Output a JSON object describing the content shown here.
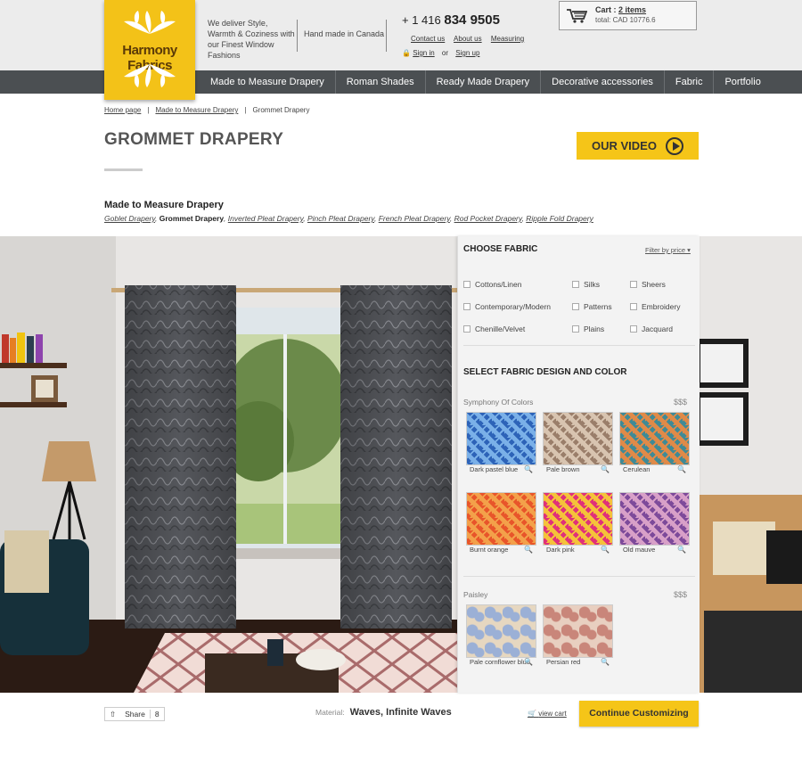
{
  "brand": {
    "name": "Harmony Fabrics"
  },
  "header": {
    "tagline": "We deliver Style, Warmth & Coziness with our Finest Window Fashions",
    "handmade": "Hand made in Canada",
    "phone_prefix": "+ 1 416",
    "phone_number": "834 9505",
    "links": [
      "Contact us",
      "About us",
      "Measuring"
    ],
    "sign_in": "Sign in",
    "or": "or",
    "sign_up": "Sign up"
  },
  "cart": {
    "label": "Cart :",
    "items": "2 items",
    "total": "total: CAD 10776.6"
  },
  "nav": [
    "Made to Measure Drapery",
    "Roman Shades",
    "Ready Made Drapery",
    "Decorative accessories",
    "Fabric",
    "Portfolio"
  ],
  "breadcrumb": [
    "Home page",
    "Made to Measure Drapery",
    "Grommet Drapery"
  ],
  "page_title": "GROMMET DRAPERY",
  "video_button": "OUR VIDEO",
  "subnav": {
    "heading": "Made to Measure Drapery",
    "items": [
      "Goblet Drapery",
      "Grommet Drapery",
      "Inverted Pleat Drapery",
      "Pinch Pleat Drapery",
      "French Pleat Drapery",
      "Rod Pocket Drapery",
      "Ripple Fold Drapery"
    ],
    "separator": ","
  },
  "panel": {
    "choose_fabric": "CHOOSE FABRIC",
    "filter": "Filter by price",
    "fabric_types": [
      "Cottons/Linen",
      "Silks",
      "Sheers",
      "Contemporary/Modern",
      "Patterns",
      "Embroidery",
      "Chenille/Velvet",
      "Plains",
      "Jacquard"
    ],
    "select_heading": "SELECT FABRIC DESIGN AND COLOR",
    "groups": [
      {
        "name": "Symphony Of Colors",
        "price": "$$$",
        "swatches": [
          {
            "label": "Dark pastel blue",
            "colors": [
              "#2d63b8",
              "#7ab0e8"
            ]
          },
          {
            "label": "Pale brown",
            "colors": [
              "#9a7e6a",
              "#d8c4b0"
            ]
          },
          {
            "label": "Cerulean",
            "colors": [
              "#3f8a96",
              "#e08a48"
            ]
          },
          {
            "label": "Burnt orange",
            "colors": [
              "#e8552a",
              "#f3a14a"
            ]
          },
          {
            "label": "Dark pink",
            "colors": [
              "#e0307a",
              "#f5c23a"
            ]
          },
          {
            "label": "Old mauve",
            "colors": [
              "#7d4a9a",
              "#d8a0c8"
            ]
          }
        ]
      },
      {
        "name": "Paisley",
        "price": "$$$",
        "swatches": [
          {
            "label": "Pale cornflower blue",
            "colors": [
              "#9bb0d6",
              "#e6d7c0"
            ]
          },
          {
            "label": "Persian red",
            "colors": [
              "#c9867a",
              "#e8cfc0"
            ]
          }
        ]
      }
    ]
  },
  "share": {
    "label": "Share",
    "count": "8"
  },
  "material": {
    "label": "Material:",
    "value": "Waves, Infinite Waves"
  },
  "view_cart": "view cart",
  "continue_button": "Continue Customizing"
}
